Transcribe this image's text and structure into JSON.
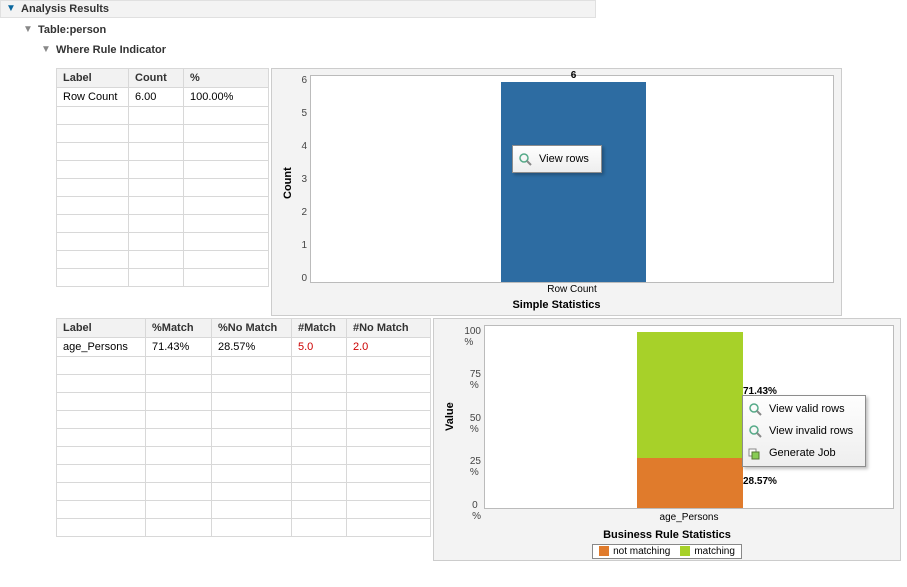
{
  "tree": {
    "root": "Analysis Results",
    "node1": "Table:person",
    "node2": "Where Rule Indicator"
  },
  "table1": {
    "headers": [
      "Label",
      "Count",
      "%"
    ],
    "rows": [
      {
        "label": "Row Count",
        "count": "6.00",
        "pct": "100.00%"
      }
    ]
  },
  "table2": {
    "headers": [
      "Label",
      "%Match",
      "%No Match",
      "#Match",
      "#No Match"
    ],
    "rows": [
      {
        "label": "age_Persons",
        "pmatch": "71.43%",
        "pnomatch": "28.57%",
        "nmatch": "5.0",
        "nnomatch": "2.0"
      }
    ]
  },
  "chart1_axis_title": "Count",
  "chart1_xcat": "Row Count",
  "chart1_title": "Simple Statistics",
  "chart1_bar_label": "6",
  "chart1_ticks": [
    "0",
    "1",
    "2",
    "3",
    "4",
    "5",
    "6"
  ],
  "chart2_axis_title": "Value",
  "chart2_title": "Business Rule Statistics",
  "chart2_xcat": "age_Persons",
  "chart2_ticks": [
    "0 %",
    "25 %",
    "50 %",
    "75 %",
    "100 %"
  ],
  "chart2_seg_top": "71.43%",
  "chart2_seg_bot": "28.57%",
  "legend": {
    "notmatch": "not matching",
    "match": "matching"
  },
  "menu1": {
    "view_rows": "View rows"
  },
  "menu2": {
    "view_valid": "View valid rows",
    "view_invalid": "View invalid rows",
    "gen_job": "Generate Job"
  },
  "colors": {
    "bar": "#2d6ca2",
    "match": "#a7d129",
    "notmatch": "#e07b2c"
  },
  "chart_data": [
    {
      "type": "bar",
      "title": "Simple Statistics",
      "categories": [
        "Row Count"
      ],
      "values": [
        6
      ],
      "xlabel": "",
      "ylabel": "Count",
      "ylim": [
        0,
        6
      ]
    },
    {
      "type": "bar",
      "title": "Business Rule Statistics",
      "categories": [
        "age_Persons"
      ],
      "series": [
        {
          "name": "not matching",
          "values": [
            28.57
          ]
        },
        {
          "name": "matching",
          "values": [
            71.43
          ]
        }
      ],
      "stacked": true,
      "xlabel": "",
      "ylabel": "Value",
      "ylim": [
        0,
        100
      ],
      "unit": "%"
    }
  ]
}
